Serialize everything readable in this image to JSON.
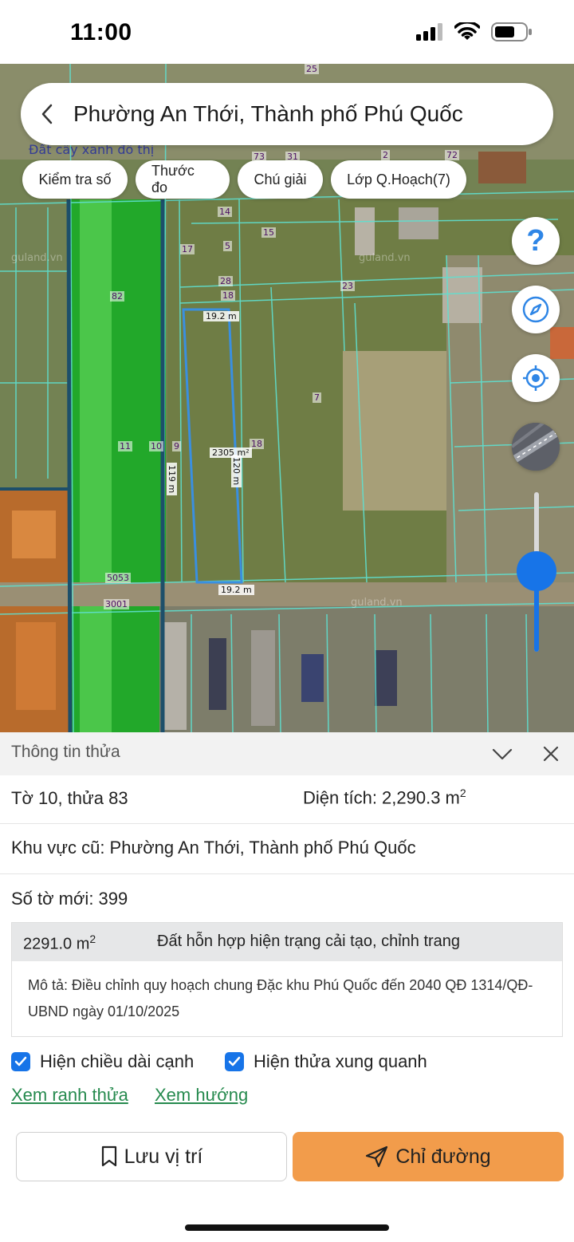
{
  "status_bar": {
    "time": "11:00"
  },
  "header": {
    "title": "Phường An Thới, Thành phố Phú Quốc"
  },
  "chips": [
    "Kiểm tra số",
    "Thước đo",
    "Chú giải",
    "Lớp Q.Hoạch(7)"
  ],
  "map": {
    "zone_text": "Đất cây xanh đô thị",
    "watermark": "guland.vn",
    "lot_numbers": {
      "a": "25",
      "b": "73",
      "c": "31",
      "d": "2",
      "e": "72",
      "f": "14",
      "g": "15",
      "h": "17",
      "i": "5",
      "j": "28",
      "k": "18",
      "l": "82",
      "m": "23",
      "n": "7",
      "o": "11",
      "p": "10",
      "q": "9",
      "r": "18",
      "s": "5053",
      "t": "3001"
    },
    "dimensions": {
      "top": "19.2 m",
      "bottom": "19.2 m",
      "left": "119 m",
      "right": "120 m",
      "area": "2305 m²"
    },
    "help_glyph": "?",
    "zoom_level": 0.49,
    "accent_color": "#1774e8",
    "parcel_outline_color": "#3a8fe0",
    "boundary_color": "#5fe0d0"
  },
  "panel": {
    "title": "Thông tin thửa",
    "sheet_parcel": "Tờ 10, thửa 83",
    "area_label": "Diện tích: 2,290.3 m",
    "area_sup": "2",
    "old_area": "Khu vực cũ: Phường An Thới, Thành phố Phú Quốc",
    "new_sheet": "Số tờ mới: 399",
    "zone_area": "2291.0 m",
    "zone_area_sup": "2",
    "zone_type": "Đất hỗn hợp hiện trạng cải tạo, chỉnh trang",
    "zone_desc": "Mô tả: Điều chỉnh quy hoạch chung Đặc khu Phú Quốc đến 2040 QĐ 1314/QĐ-UBND ngày 01/10/2025",
    "check_edges": "Hiện chiều dài cạnh",
    "check_neighbors": "Hiện thửa xung quanh",
    "link_boundary": "Xem ranh thửa",
    "link_direction": "Xem hướng",
    "save_label": "Lưu vị trí",
    "directions_label": "Chỉ đường",
    "directions_color": "#f29c4b"
  }
}
